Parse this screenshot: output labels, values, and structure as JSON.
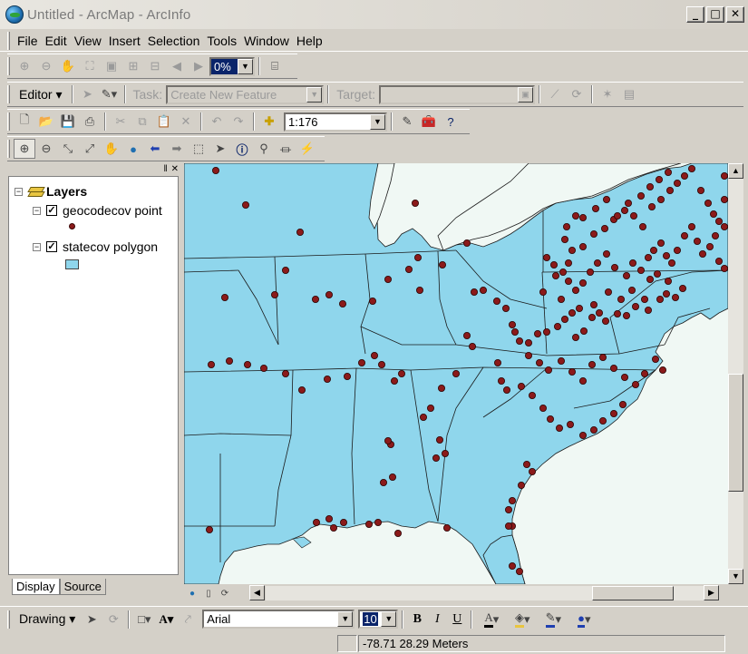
{
  "window": {
    "title": "Untitled - ArcMap - ArcInfo",
    "controls": [
      "_",
      "□",
      "✕"
    ]
  },
  "menu": [
    "File",
    "Edit",
    "View",
    "Insert",
    "Selection",
    "Tools",
    "Window",
    "Help"
  ],
  "layout_toolbar": {
    "zoom_percent": "0%"
  },
  "editor_toolbar": {
    "editor_label": "Editor",
    "task_label": "Task:",
    "task_value": "Create New Feature",
    "target_label": "Target:",
    "target_value": ""
  },
  "standard_toolbar": {
    "scale_value": "1:176"
  },
  "toc": {
    "root_label": "Layers",
    "layers": [
      {
        "name": "geocodecov point",
        "checked": true,
        "symbol": "point"
      },
      {
        "name": "statecov polygon",
        "checked": true,
        "symbol": "polygon"
      }
    ],
    "tabs": [
      "Display",
      "Source"
    ],
    "active_tab": "Display"
  },
  "map": {
    "land_color": "#8fd6ec",
    "water_color": "#f0f8f4",
    "point_color": "#8b1a1a",
    "boundary_color": "#1a1a1a"
  },
  "drawing_toolbar": {
    "drawing_label": "Drawing",
    "font_name": "Arial",
    "font_size": "10",
    "bold": "B",
    "italic": "I",
    "underline": "U",
    "text_tool": "A"
  },
  "status": {
    "coordinates": "-78.71  28.29 Meters"
  }
}
